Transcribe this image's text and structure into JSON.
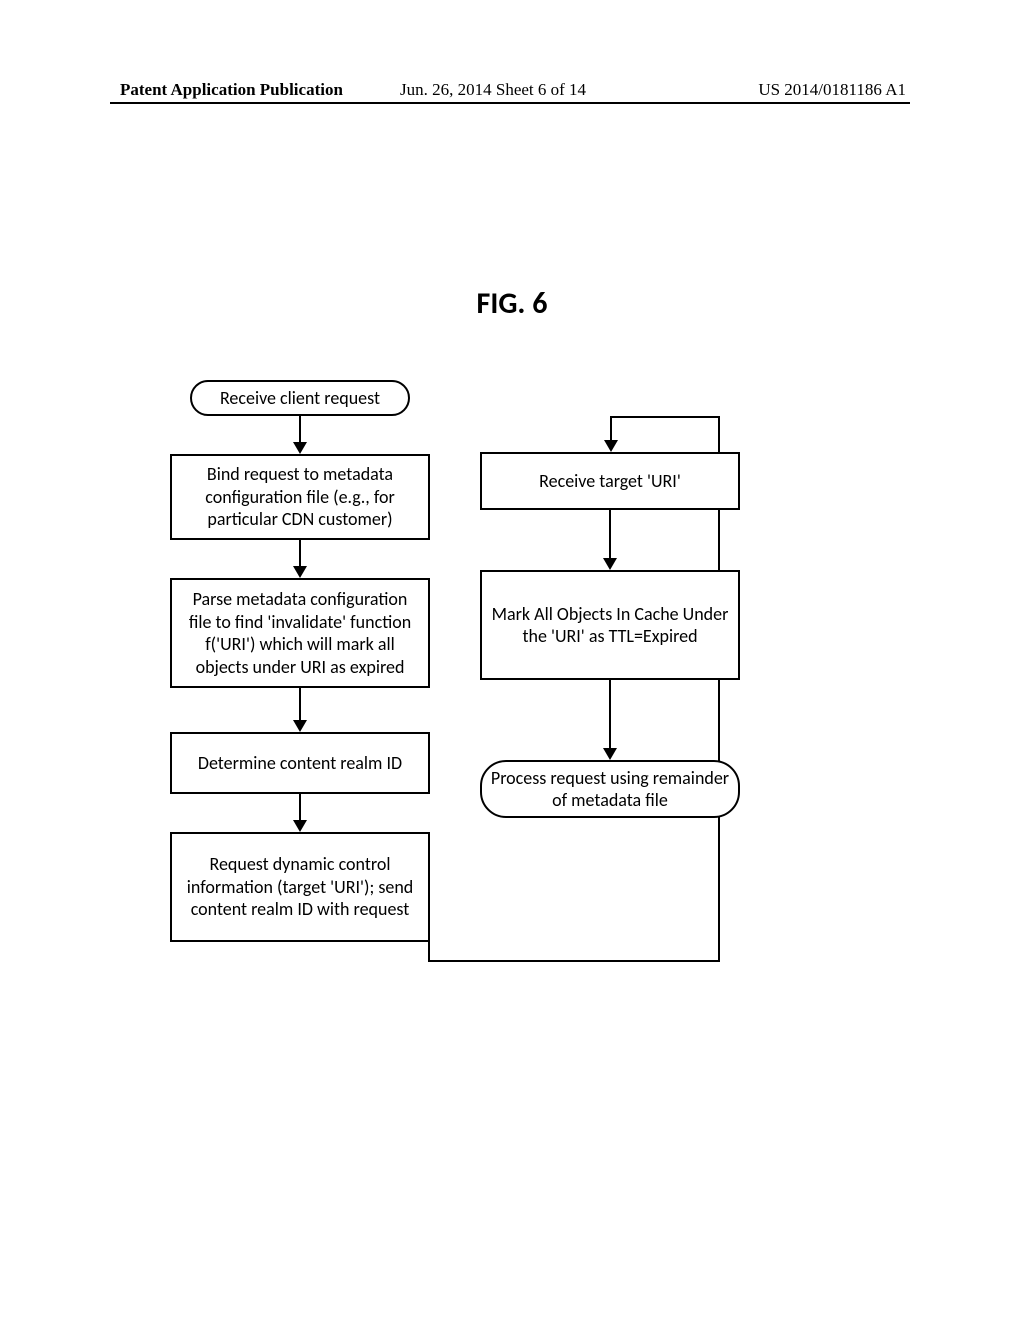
{
  "header": {
    "left": "Patent Application Publication",
    "mid": "Jun. 26, 2014  Sheet 6 of 14",
    "right": "US 2014/0181186 A1"
  },
  "figTitle": "FIG. 6",
  "nodes": {
    "start": "Receive client request",
    "bind": "Bind request to metadata configuration file (e.g., for particular CDN customer)",
    "parse": "Parse metadata configuration file to find 'invalidate' function f('URI') which will mark all objects under URI as expired",
    "realm": "Determine content realm ID",
    "request": "Request dynamic control information (target 'URI'); send content realm ID with request",
    "receive": "Receive target 'URI'",
    "mark": "Mark All Objects In Cache Under the 'URI' as TTL=Expired",
    "process": "Process request using remainder of metadata file"
  }
}
